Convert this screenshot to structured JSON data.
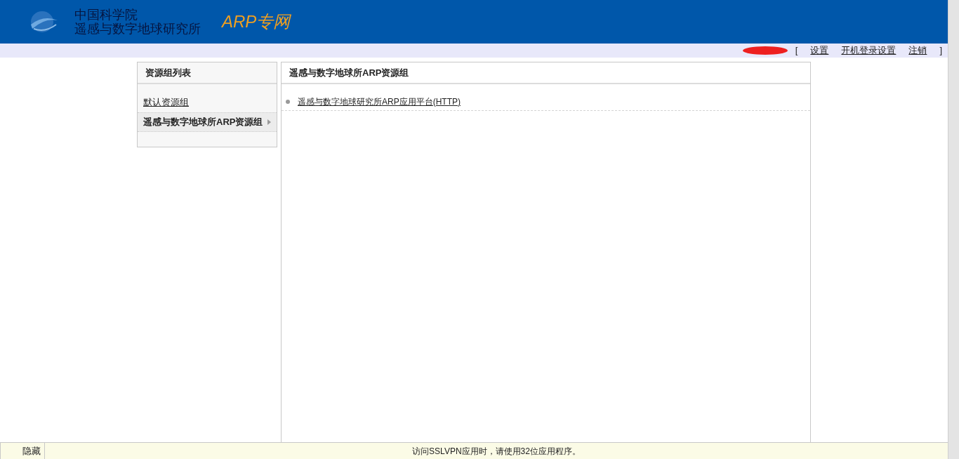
{
  "header": {
    "org_line_1": "中国科学院",
    "org_line_2": "遥感与数字地球研究所",
    "product": "ARP专网"
  },
  "top_links": {
    "open_bracket": "[",
    "links": [
      "设置",
      "开机登录设置",
      "注销"
    ],
    "close_bracket": "]"
  },
  "sidebar": {
    "title": "资源组列表",
    "items": [
      {
        "label": "默认资源组",
        "selected": false
      },
      {
        "label": "遥感与数字地球所ARP资源组",
        "selected": true
      }
    ]
  },
  "content": {
    "title": "遥感与数字地球所ARP资源组",
    "resources": [
      {
        "label": "遥感与数字地球研究所ARP应用平台(HTTP)"
      }
    ]
  },
  "status_bar": {
    "hide_button": "隐藏",
    "message": "访问SSLVPN应用时，请使用32位应用程序。"
  }
}
